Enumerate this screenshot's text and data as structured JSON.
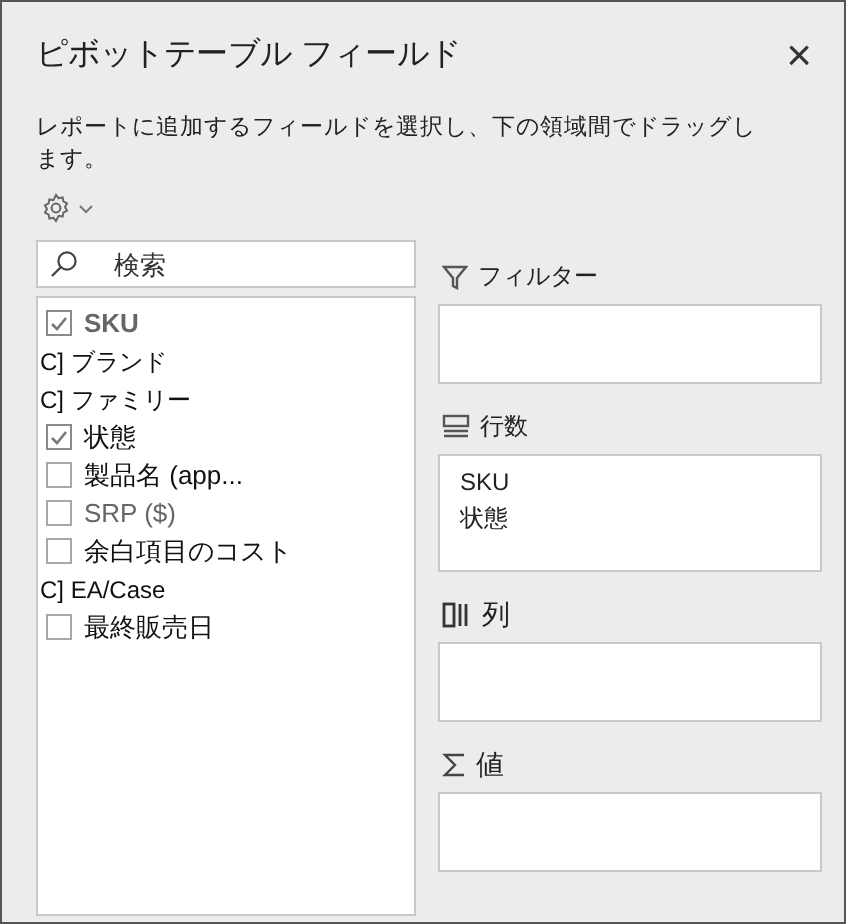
{
  "window": {
    "title": "ピボットテーブル フィールド",
    "close": "×"
  },
  "instruction": "レポートに追加するフィールドを選択し、下の領域間でドラッグします。",
  "search": {
    "placeholder": "検索"
  },
  "fields": [
    {
      "kind": "checkbox",
      "label": "SKU",
      "checked": true,
      "dim": true,
      "bold": true
    },
    {
      "kind": "text",
      "label": "C] ブランド"
    },
    {
      "kind": "text",
      "label": "C] ファミリー"
    },
    {
      "kind": "checkbox",
      "label": "状態",
      "checked": true
    },
    {
      "kind": "checkbox",
      "label": "製品名 (app...",
      "checked": false
    },
    {
      "kind": "checkbox",
      "label": "SRP ($)",
      "checked": false,
      "dim": true
    },
    {
      "kind": "checkbox",
      "label": "余白項目のコスト",
      "checked": false
    },
    {
      "kind": "text",
      "label": "C] EA/Case"
    },
    {
      "kind": "checkbox",
      "label": "最終販売日",
      "checked": false
    }
  ],
  "areas": [
    {
      "kind": "filter",
      "label": "フィルター"
    },
    {
      "kind": "rows",
      "label": "行数",
      "items": [
        "SKU",
        "状態"
      ]
    },
    {
      "kind": "columns",
      "label": "列"
    },
    {
      "kind": "values",
      "label": "値"
    }
  ]
}
